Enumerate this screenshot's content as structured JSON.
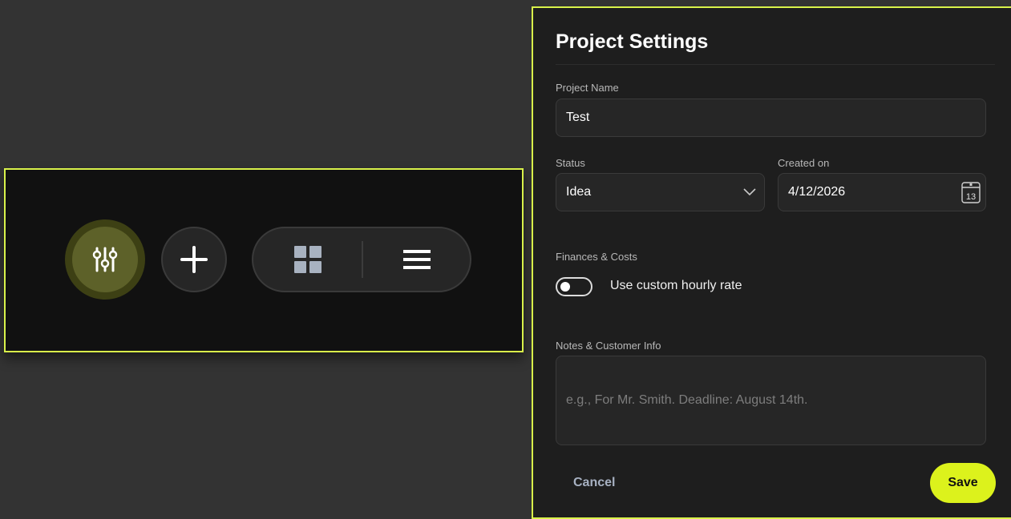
{
  "colors": {
    "accent": "#d9f24a",
    "save_button": "#dcf21c",
    "panel_background": "#1e1e1e",
    "page_background": "#333333"
  },
  "toolbar": {
    "filter_icon": "sliders-icon",
    "add_icon": "plus-icon",
    "grid_view_icon": "grid-icon",
    "list_view_icon": "list-icon"
  },
  "settings": {
    "title": "Project Settings",
    "project_name": {
      "label": "Project Name",
      "value": "Test"
    },
    "status": {
      "label": "Status",
      "value": "Idea",
      "icon": "chevron-down-icon"
    },
    "created_on": {
      "label": "Created on",
      "value": "4/12/2026",
      "icon": "calendar-icon",
      "calendar_day": "13"
    },
    "finances": {
      "label": "Finances & Costs",
      "toggle_label": "Use custom hourly rate",
      "toggle_on": false
    },
    "notes": {
      "label": "Notes & Customer Info",
      "placeholder": "e.g., For Mr. Smith. Deadline: August 14th."
    },
    "cancel_label": "Cancel",
    "save_label": "Save"
  }
}
